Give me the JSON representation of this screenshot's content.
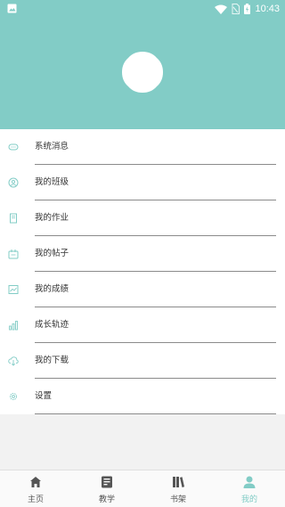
{
  "status_bar": {
    "time": "10:43"
  },
  "colors": {
    "primary": "#82ccc6",
    "text": "#333333",
    "divider": "#8b8b8b",
    "tab_inactive": "#555555"
  },
  "menu": {
    "items": [
      {
        "label": "系统消息",
        "icon": "message-icon"
      },
      {
        "label": "我的班级",
        "icon": "class-icon"
      },
      {
        "label": "我的作业",
        "icon": "homework-icon"
      },
      {
        "label": "我的帖子",
        "icon": "post-icon"
      },
      {
        "label": "我的成绩",
        "icon": "grades-icon"
      },
      {
        "label": "成长轨迹",
        "icon": "growth-icon"
      },
      {
        "label": "我的下载",
        "icon": "download-icon"
      },
      {
        "label": "设置",
        "icon": "settings-icon"
      }
    ]
  },
  "tabbar": {
    "tabs": [
      {
        "label": "主页",
        "icon": "home-icon",
        "active": false
      },
      {
        "label": "教学",
        "icon": "teaching-icon",
        "active": false
      },
      {
        "label": "书架",
        "icon": "bookshelf-icon",
        "active": false
      },
      {
        "label": "我的",
        "icon": "profile-icon",
        "active": true
      }
    ]
  }
}
